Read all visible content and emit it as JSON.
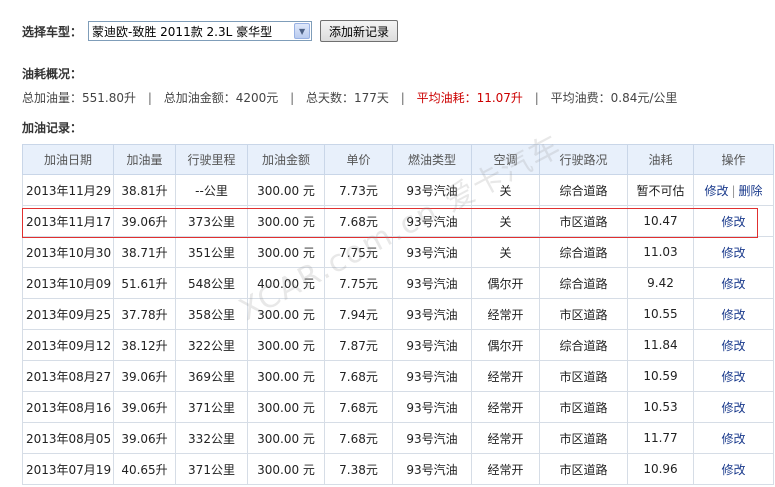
{
  "car_select": {
    "label": "选择车型：",
    "selected": "蒙迪欧-致胜 2011款 2.3L 豪华型",
    "add_button": "添加新记录"
  },
  "summary": {
    "title": "油耗概况：",
    "total_fuel": "总加油量：551.80升",
    "total_amount": "总加油金额：4200元",
    "total_days": "总天数：177天",
    "avg_consumption": "平均油耗：11.07升",
    "avg_cost": "平均油费：0.84元/公里",
    "separator": "|"
  },
  "records": {
    "title": "加油记录：",
    "headers": [
      "加油日期",
      "加油量",
      "行驶里程",
      "加油金额",
      "单价",
      "燃油类型",
      "空调",
      "行驶路况",
      "油耗",
      "操作"
    ],
    "rows": [
      {
        "date": "2013年11月29日",
        "fuel": "38.81升",
        "mileage": "--公里",
        "amount": "300.00 元",
        "price": "7.73元",
        "fuel_type": "93号汽油",
        "ac": "关",
        "road": "综合道路",
        "consumption": "暂不可估",
        "edit": "修改",
        "delete": "删除"
      },
      {
        "date": "2013年11月17日",
        "fuel": "39.06升",
        "mileage": "373公里",
        "amount": "300.00 元",
        "price": "7.68元",
        "fuel_type": "93号汽油",
        "ac": "关",
        "road": "市区道路",
        "consumption": "10.47",
        "edit": "修改"
      },
      {
        "date": "2013年10月30日",
        "fuel": "38.71升",
        "mileage": "351公里",
        "amount": "300.00 元",
        "price": "7.75元",
        "fuel_type": "93号汽油",
        "ac": "关",
        "road": "综合道路",
        "consumption": "11.03",
        "edit": "修改"
      },
      {
        "date": "2013年10月09日",
        "fuel": "51.61升",
        "mileage": "548公里",
        "amount": "400.00 元",
        "price": "7.75元",
        "fuel_type": "93号汽油",
        "ac": "偶尔开",
        "road": "综合道路",
        "consumption": "9.42",
        "edit": "修改"
      },
      {
        "date": "2013年09月25日",
        "fuel": "37.78升",
        "mileage": "358公里",
        "amount": "300.00 元",
        "price": "7.94元",
        "fuel_type": "93号汽油",
        "ac": "经常开",
        "road": "市区道路",
        "consumption": "10.55",
        "edit": "修改"
      },
      {
        "date": "2013年09月12日",
        "fuel": "38.12升",
        "mileage": "322公里",
        "amount": "300.00 元",
        "price": "7.87元",
        "fuel_type": "93号汽油",
        "ac": "偶尔开",
        "road": "综合道路",
        "consumption": "11.84",
        "edit": "修改"
      },
      {
        "date": "2013年08月27日",
        "fuel": "39.06升",
        "mileage": "369公里",
        "amount": "300.00 元",
        "price": "7.68元",
        "fuel_type": "93号汽油",
        "ac": "经常开",
        "road": "市区道路",
        "consumption": "10.59",
        "edit": "修改"
      },
      {
        "date": "2013年08月16日",
        "fuel": "39.06升",
        "mileage": "371公里",
        "amount": "300.00 元",
        "price": "7.68元",
        "fuel_type": "93号汽油",
        "ac": "经常开",
        "road": "市区道路",
        "consumption": "10.53",
        "edit": "修改"
      },
      {
        "date": "2013年08月05日",
        "fuel": "39.06升",
        "mileage": "332公里",
        "amount": "300.00 元",
        "price": "7.68元",
        "fuel_type": "93号汽油",
        "ac": "经常开",
        "road": "市区道路",
        "consumption": "11.77",
        "edit": "修改"
      },
      {
        "date": "2013年07月19日",
        "fuel": "40.65升",
        "mileage": "371公里",
        "amount": "300.00 元",
        "price": "7.38元",
        "fuel_type": "93号汽油",
        "ac": "经常开",
        "road": "市区道路",
        "consumption": "10.96",
        "edit": "修改"
      }
    ]
  },
  "watermark": "XCAR.com.cn 爱卡汽车",
  "colors": {
    "highlight": "#cc0000",
    "link": "#1a3a8c",
    "header_bg": "#e8f0fb"
  }
}
